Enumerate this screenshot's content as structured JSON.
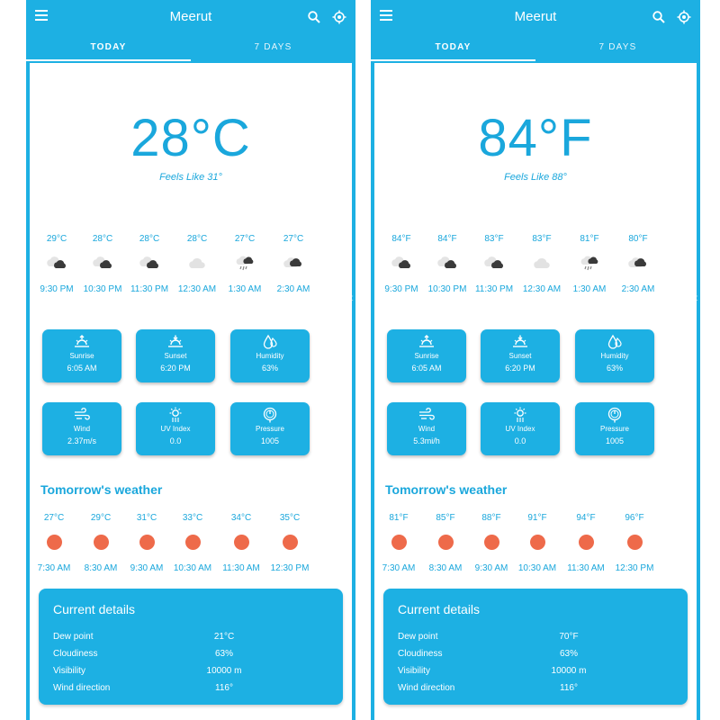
{
  "panels": [
    {
      "city": "Meerut",
      "tabs": [
        "TODAY",
        "7 DAYS"
      ],
      "temperature": "28°C",
      "feels_like": "Feels Like 31°",
      "hourly": [
        {
          "temp": "29°C",
          "time": "9:30 PM",
          "icon": "cloudy-night-icon"
        },
        {
          "temp": "28°C",
          "time": "10:30 PM",
          "icon": "cloudy-night-icon"
        },
        {
          "temp": "28°C",
          "time": "11:30 PM",
          "icon": "cloudy-night-icon"
        },
        {
          "temp": "28°C",
          "time": "12:30 AM",
          "icon": "cloud-icon"
        },
        {
          "temp": "27°C",
          "time": "1:30 AM",
          "icon": "rain-night-icon"
        },
        {
          "temp": "27°C",
          "time": "2:30 AM",
          "icon": "cloudy-night-icon"
        }
      ],
      "hourly_more": ":",
      "tiles": [
        {
          "label": "Sunrise",
          "value": "6:05 AM",
          "icon": "sunrise-icon"
        },
        {
          "label": "Sunset",
          "value": "6:20 PM",
          "icon": "sunset-icon"
        },
        {
          "label": "Humidity",
          "value": "63%",
          "icon": "humidity-icon"
        },
        {
          "label": "Wind",
          "value": "2.37m/s",
          "icon": "wind-icon"
        },
        {
          "label": "UV Index",
          "value": "0.0",
          "icon": "uv-index-icon"
        },
        {
          "label": "Pressure",
          "value": "1005",
          "icon": "pressure-icon"
        }
      ],
      "tomorrow_title": "Tomorrow's weather",
      "tomorrow": [
        {
          "temp": "27°C",
          "time": "7:30 AM"
        },
        {
          "temp": "29°C",
          "time": "8:30 AM"
        },
        {
          "temp": "31°C",
          "time": "9:30 AM"
        },
        {
          "temp": "33°C",
          "time": "10:30 AM"
        },
        {
          "temp": "34°C",
          "time": "11:30 AM"
        },
        {
          "temp": "35°C",
          "time": "12:30 PM"
        }
      ],
      "details_title": "Current details",
      "details": [
        {
          "label": "Dew point",
          "value": "21°C"
        },
        {
          "label": "Cloudiness",
          "value": "63%"
        },
        {
          "label": "Visibility",
          "value": "10000 m"
        },
        {
          "label": "Wind direction",
          "value": "116°"
        }
      ]
    },
    {
      "city": "Meerut",
      "tabs": [
        "TODAY",
        "7 DAYS"
      ],
      "temperature": "84°F",
      "feels_like": "Feels Like 88°",
      "hourly": [
        {
          "temp": "84°F",
          "time": "9:30 PM",
          "icon": "cloudy-night-icon"
        },
        {
          "temp": "84°F",
          "time": "10:30 PM",
          "icon": "cloudy-night-icon"
        },
        {
          "temp": "83°F",
          "time": "11:30 PM",
          "icon": "cloudy-night-icon"
        },
        {
          "temp": "83°F",
          "time": "12:30 AM",
          "icon": "cloud-icon"
        },
        {
          "temp": "81°F",
          "time": "1:30 AM",
          "icon": "rain-night-icon"
        },
        {
          "temp": "80°F",
          "time": "2:30 AM",
          "icon": "cloudy-night-icon"
        }
      ],
      "hourly_more": ":",
      "tiles": [
        {
          "label": "Sunrise",
          "value": "6:05 AM",
          "icon": "sunrise-icon"
        },
        {
          "label": "Sunset",
          "value": "6:20 PM",
          "icon": "sunset-icon"
        },
        {
          "label": "Humidity",
          "value": "63%",
          "icon": "humidity-icon"
        },
        {
          "label": "Wind",
          "value": "5.3mi/h",
          "icon": "wind-icon"
        },
        {
          "label": "UV Index",
          "value": "0.0",
          "icon": "uv-index-icon"
        },
        {
          "label": "Pressure",
          "value": "1005",
          "icon": "pressure-icon"
        }
      ],
      "tomorrow_title": "Tomorrow's weather",
      "tomorrow": [
        {
          "temp": "81°F",
          "time": "7:30 AM"
        },
        {
          "temp": "85°F",
          "time": "8:30 AM"
        },
        {
          "temp": "88°F",
          "time": "9:30 AM"
        },
        {
          "temp": "91°F",
          "time": "10:30 AM"
        },
        {
          "temp": "94°F",
          "time": "11:30 AM"
        },
        {
          "temp": "96°F",
          "time": "12:30 PM"
        }
      ],
      "details_title": "Current details",
      "details": [
        {
          "label": "Dew point",
          "value": "70°F"
        },
        {
          "label": "Cloudiness",
          "value": "63%"
        },
        {
          "label": "Visibility",
          "value": "10000 m"
        },
        {
          "label": "Wind direction",
          "value": "116°"
        }
      ]
    }
  ],
  "colors": {
    "primary": "#1db0e3",
    "text_accent": "#1aa7dc",
    "sun": "#ee6a4a"
  }
}
